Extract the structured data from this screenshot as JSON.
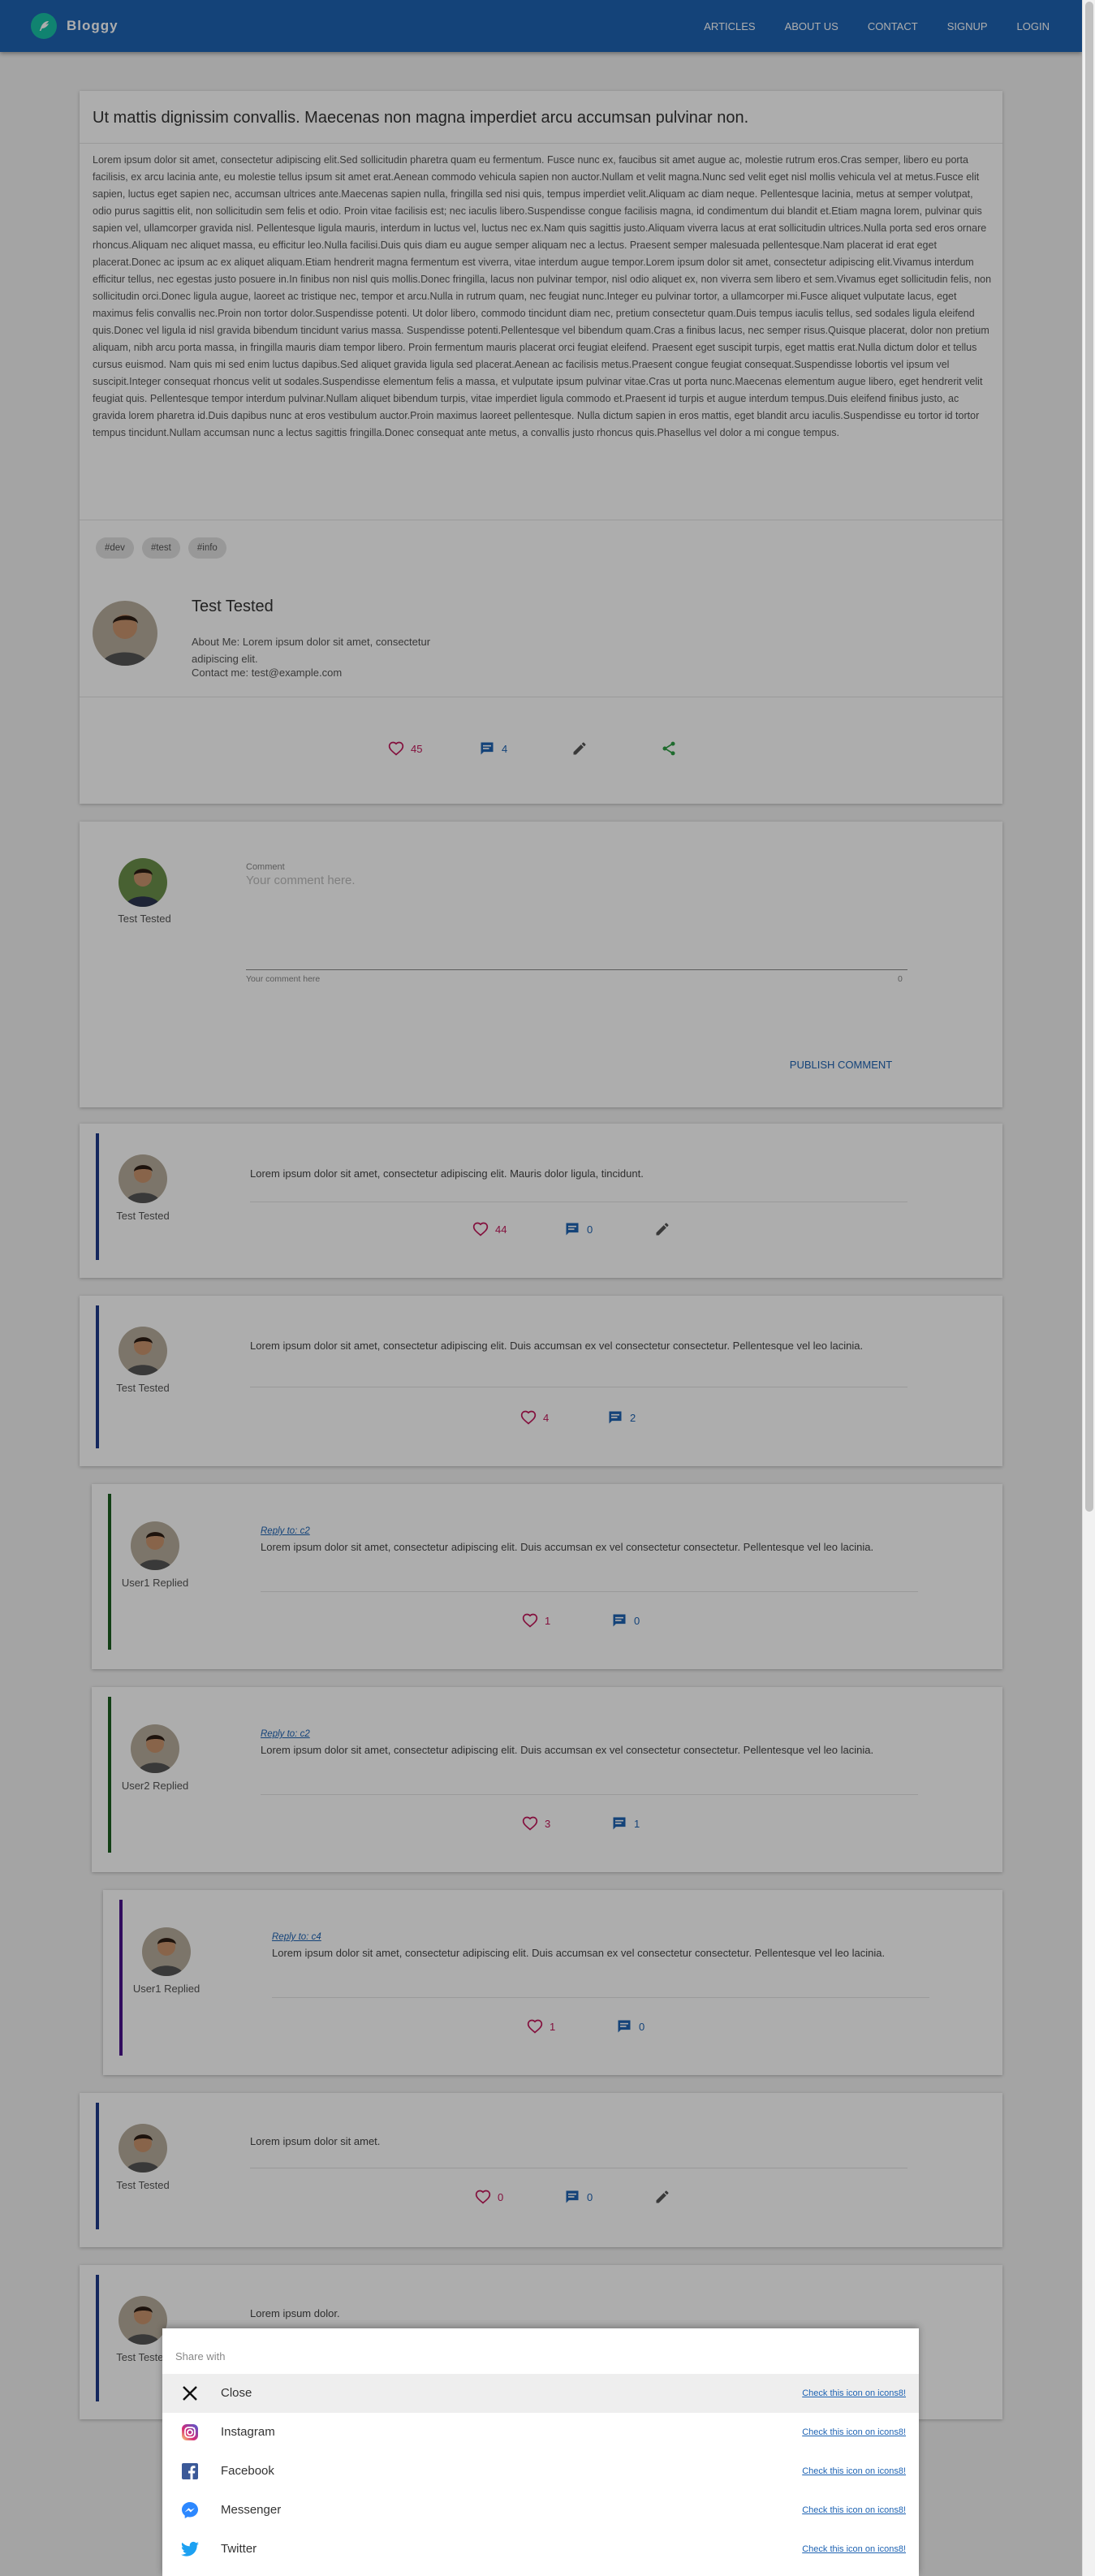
{
  "header": {
    "logo": "Bloggy",
    "nav": [
      "ARTICLES",
      "ABOUT US",
      "CONTACT",
      "SIGNUP",
      "LOGIN"
    ]
  },
  "post": {
    "title": "Ut mattis dignissim convallis. Maecenas non magna imperdiet arcu accumsan pulvinar non.",
    "body": "Lorem ipsum dolor sit amet, consectetur adipiscing elit.Sed sollicitudin pharetra quam eu fermentum. Fusce nunc ex, faucibus sit amet augue ac, molestie rutrum eros.Cras semper, libero eu porta facilisis, ex arcu lacinia ante, eu molestie tellus ipsum sit amet erat.Aenean commodo vehicula sapien non auctor.Nullam et velit magna.Nunc sed velit eget nisl mollis vehicula vel at metus.Fusce elit sapien, luctus eget sapien nec, accumsan ultrices ante.Maecenas sapien nulla, fringilla sed nisi quis, tempus imperdiet velit.Aliquam ac diam neque. Pellentesque lacinia, metus at semper volutpat, odio purus sagittis elit, non sollicitudin sem felis et odio. Proin vitae facilisis est; nec iaculis libero.Suspendisse congue facilisis magna, id condimentum dui blandit et.Etiam magna lorem, pulvinar quis sapien vel, ullamcorper gravida nisl. Pellentesque ligula mauris, interdum in luctus vel, luctus nec ex.Nam quis sagittis justo.Aliquam viverra lacus at erat sollicitudin ultrices.Nulla porta sed eros ornare rhoncus.Aliquam nec aliquet massa, eu efficitur leo.Nulla facilisi.Duis quis diam eu augue semper aliquam nec a lectus. Praesent semper malesuada pellentesque.Nam placerat id erat eget placerat.Donec ac ipsum ac ex aliquet aliquam.Etiam hendrerit magna fermentum est viverra, vitae interdum augue tempor.Lorem ipsum dolor sit amet, consectetur adipiscing elit.Vivamus interdum efficitur tellus, nec egestas justo posuere in.In finibus non nisl quis mollis.Donec fringilla, lacus non pulvinar tempor, nisl odio aliquet ex, non viverra sem libero et sem.Vivamus eget sollicitudin felis, non sollicitudin orci.Donec ligula augue, laoreet ac tristique nec, tempor et arcu.Nulla in rutrum quam, nec feugiat nunc.Integer eu pulvinar tortor, a ullamcorper mi.Fusce aliquet vulputate lacus, eget maximus felis convallis nec.Proin non tortor dolor.Suspendisse potenti. Ut dolor libero, commodo tincidunt diam nec, pretium consectetur quam.Duis tempus iaculis tellus, sed sodales ligula eleifend quis.Donec vel ligula id nisl gravida bibendum tincidunt varius massa. Suspendisse potenti.Pellentesque vel bibendum quam.Cras a finibus lacus, nec semper risus.Quisque placerat, dolor non pretium aliquam, nibh arcu porta massa, in fringilla mauris diam tempor libero. Proin fermentum mauris placerat orci feugiat eleifend. Praesent eget suscipit turpis, eget mattis erat.Nulla dictum dolor et tellus cursus euismod. Nam quis mi sed enim luctus dapibus.Sed aliquet gravida ligula sed placerat.Aenean ac facilisis metus.Praesent congue feugiat consequat.Suspendisse lobortis vel ipsum vel suscipit.Integer consequat rhoncus velit ut sodales.Suspendisse elementum felis a massa, et vulputate ipsum pulvinar vitae.Cras ut porta nunc.Maecenas elementum augue libero, eget hendrerit velit feugiat quis. Pellentesque tempor interdum pulvinar.Nullam aliquet bibendum turpis, vitae imperdiet ligula commodo et.Praesent id turpis et augue interdum tempus.Duis eleifend finibus justo, ac gravida lorem pharetra id.Duis dapibus nunc at eros vestibulum auctor.Proin maximus laoreet pellentesque. Nulla dictum sapien in eros mattis, eget blandit arcu iaculis.Suspendisse eu tortor id tortor tempus tincidunt.Nullam accumsan nunc a lectus sagittis fringilla.Donec consequat ante metus, a convallis justo rhoncus quis.Phasellus vel dolor a mi congue tempus.",
    "tags": [
      "#dev",
      "#test",
      "#info"
    ],
    "author": {
      "name": "Test Tested",
      "about": "About Me: Lorem ipsum dolor sit amet, consectetur adipiscing elit.",
      "contact": "Contact me: test@example.com"
    },
    "likes": "45",
    "comments": "4"
  },
  "comment_form": {
    "user": "Test Tested",
    "label": "Comment",
    "placeholder": "Your comment here.",
    "helper": "Your comment here",
    "counter": "0",
    "publish": "PUBLISH COMMENT"
  },
  "comments": [
    {
      "user": "Test Tested",
      "reply_to": "",
      "text": "Lorem ipsum dolor sit amet, consectetur adipiscing elit. Mauris dolor ligula, tincidunt.",
      "likes": "44",
      "replies": "0"
    },
    {
      "user": "Test Tested",
      "reply_to": "",
      "text": "Lorem ipsum dolor sit amet, consectetur adipiscing elit. Duis accumsan ex vel consectetur consectetur. Pellentesque vel leo lacinia.",
      "likes": "4",
      "replies": "2"
    },
    {
      "user": "User1 Replied",
      "reply_to": "Reply to: c2",
      "text": "Lorem ipsum dolor sit amet, consectetur adipiscing elit. Duis accumsan ex vel consectetur consectetur. Pellentesque vel leo lacinia.",
      "likes": "1",
      "replies": "0"
    },
    {
      "user": "User2 Replied",
      "reply_to": "Reply to: c2",
      "text": "Lorem ipsum dolor sit amet, consectetur adipiscing elit. Duis accumsan ex vel consectetur consectetur. Pellentesque vel leo lacinia.",
      "likes": "3",
      "replies": "1"
    },
    {
      "user": "User1 Replied",
      "reply_to": "Reply to: c4",
      "text": "Lorem ipsum dolor sit amet, consectetur adipiscing elit. Duis accumsan ex vel consectetur consectetur. Pellentesque vel leo lacinia.",
      "likes": "1",
      "replies": "0"
    },
    {
      "user": "Test Tested",
      "reply_to": "",
      "text": "Lorem ipsum dolor sit amet.",
      "likes": "0",
      "replies": "0"
    },
    {
      "user": "Test Tested",
      "reply_to": "",
      "text": "Lorem ipsum dolor."
    }
  ],
  "share": {
    "title": "Share with",
    "items": [
      {
        "label": "Close",
        "icon": "close-icon",
        "link": "Check this icon on icons8!"
      },
      {
        "label": "Instagram",
        "icon": "instagram-icon",
        "link": "Check this icon on icons8!"
      },
      {
        "label": "Facebook",
        "icon": "facebook-icon",
        "link": "Check this icon on icons8!"
      },
      {
        "label": "Messenger",
        "icon": "messenger-icon",
        "link": "Check this icon on icons8!"
      },
      {
        "label": "Twitter",
        "icon": "twitter-icon",
        "link": "Check this icon on icons8!"
      }
    ]
  },
  "colors": {
    "primary": "#1e63b3",
    "like": "#c2185b",
    "share": "#2e9e44",
    "bar_level0": "#1e3a8a",
    "bar_level1": "#1b5e20",
    "bar_level2": "#4a148c"
  }
}
